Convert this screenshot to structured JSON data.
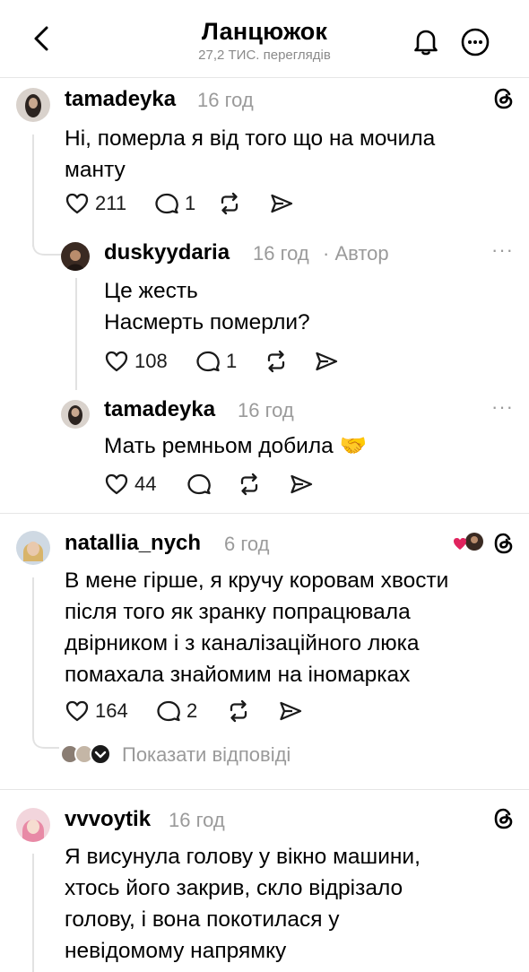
{
  "header": {
    "title": "Ланцюжок",
    "views": "27,2 ТИС. переглядів"
  },
  "posts": [
    {
      "username": "tamadeyka",
      "time": "16 год",
      "text": "Ні, померла я від того що на мочила\nманту",
      "likes": "211",
      "replies": "1"
    },
    {
      "username": "duskyydaria",
      "time": "16 год",
      "author_tag": "· Автор",
      "text": "Це жесть\nНасмерть померли?",
      "likes": "108",
      "replies": "1"
    },
    {
      "username": "tamadeyka",
      "time": "16 год",
      "text": "Мать ремньом добила 🤝",
      "likes": "44",
      "replies": ""
    },
    {
      "username": "natallia_nych",
      "time": "6 год",
      "text": "В мене гірше, я кручу коровам хвости\nпісля того як зранку попрацювала\nдвірником і з каналізаційного люка\nпомахала знайомим на іномарках",
      "likes": "164",
      "replies": "2",
      "show_replies": "Показати відповіді"
    },
    {
      "username": "vvvoytik",
      "time": "16 год",
      "text": "Я висунула голову у вікно машини,\nхтось його закрив, скло відрізало\nголову, і вона покотилася у\nневідомому напрямку"
    }
  ],
  "icons": [
    "back-arrow-icon",
    "bell-icon",
    "more-icon",
    "threads-icon",
    "heart-icon",
    "comment-icon",
    "repost-icon",
    "share-icon"
  ],
  "colors": {
    "text": "#000000",
    "muted": "#9a9a9a",
    "divider": "#e6e6e6",
    "heart_red": "#e0245e"
  }
}
